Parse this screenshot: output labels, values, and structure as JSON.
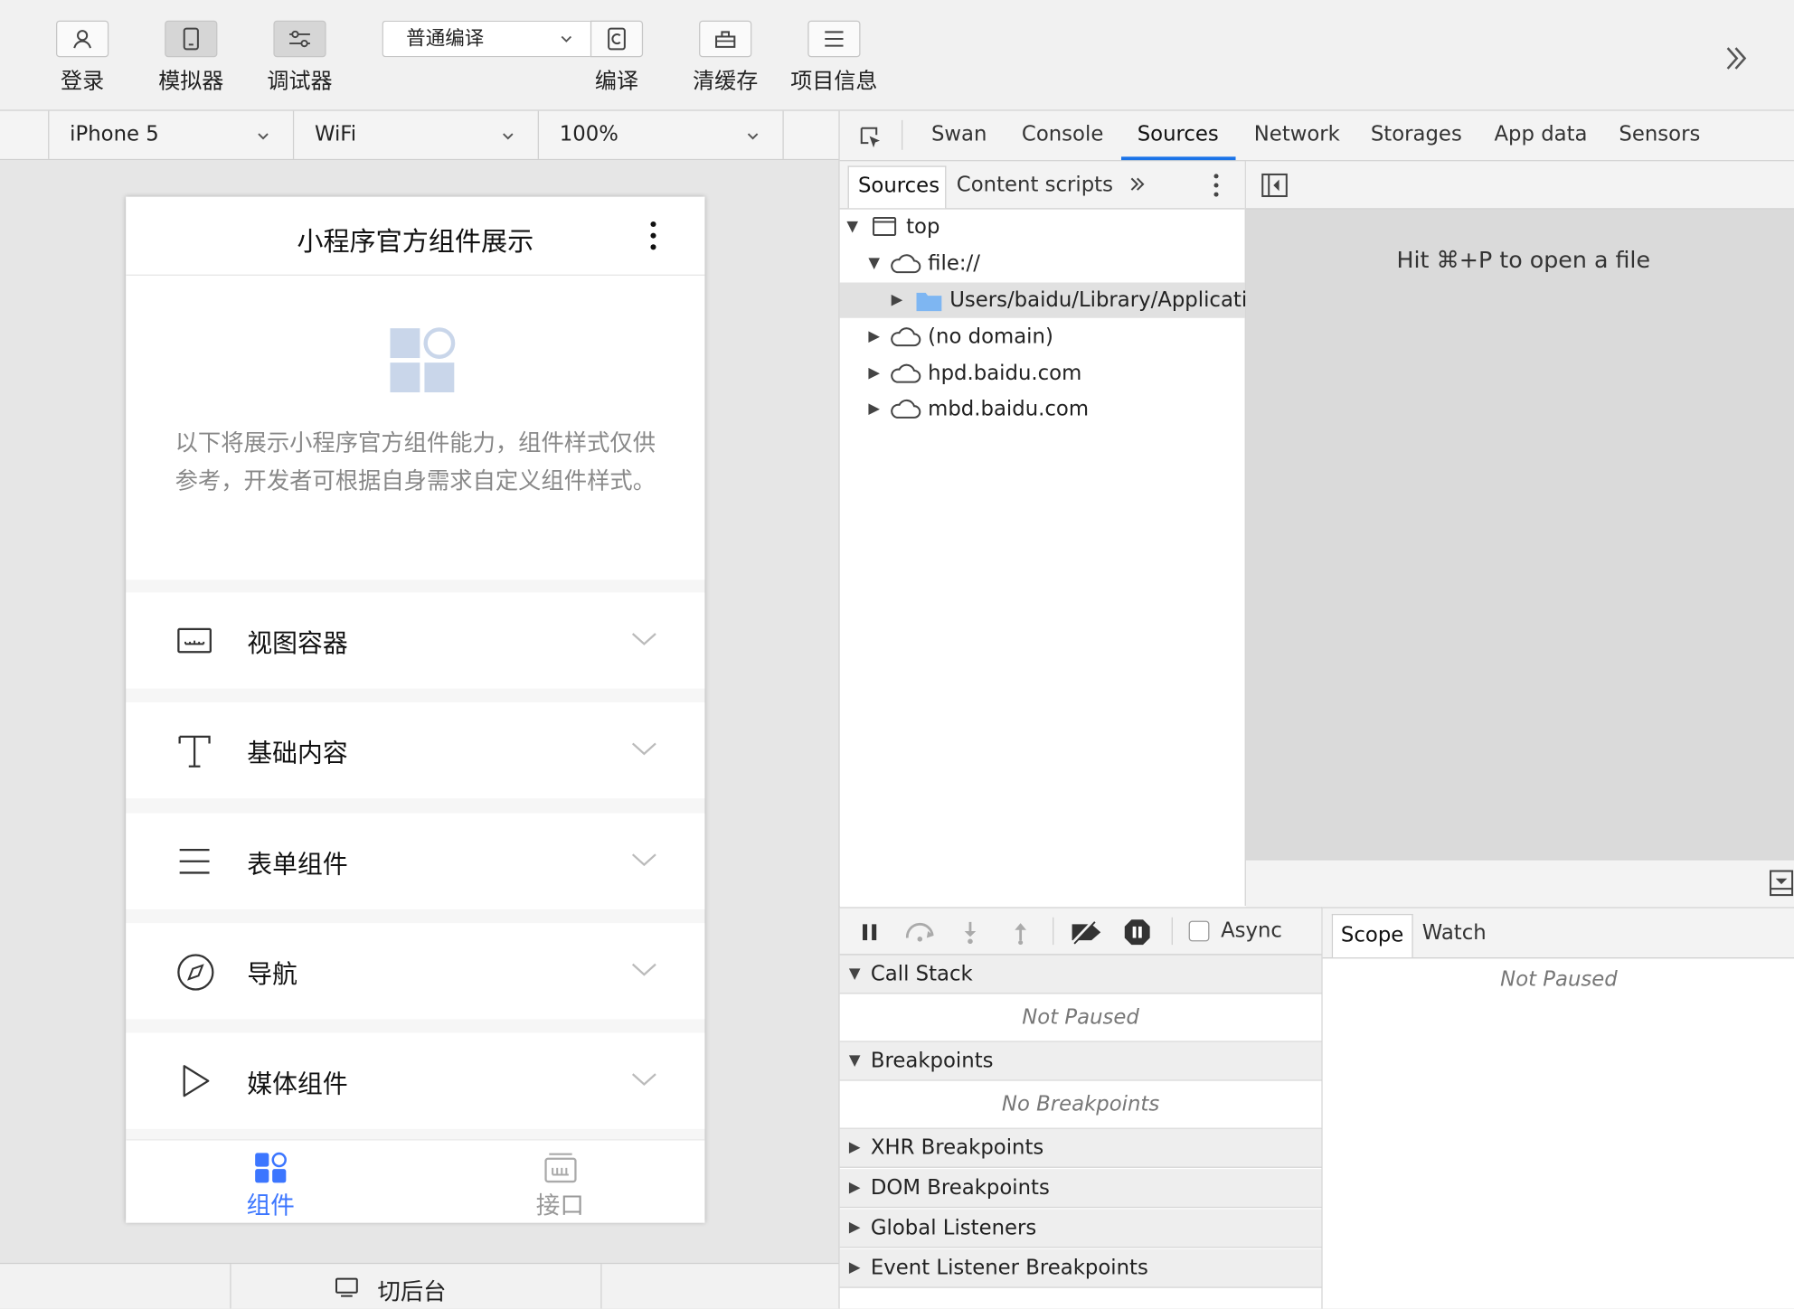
{
  "toolbar": {
    "login": "登录",
    "simulator": "模拟器",
    "debugger": "调试器",
    "compile_mode": "普通编译",
    "compile": "编译",
    "clear_cache": "清缓存",
    "project_info": "项目信息"
  },
  "device_bar": {
    "device": "iPhone 5",
    "network": "WiFi",
    "zoom": "100%"
  },
  "phone": {
    "title": "小程序官方组件展示",
    "intro": "以下将展示小程序官方组件能力，组件样式仅供参考，开发者可根据自身需求自定义组件样式。",
    "components": [
      "视图容器",
      "基础内容",
      "表单组件",
      "导航",
      "媒体组件"
    ],
    "tabs": [
      "组件",
      "接口"
    ],
    "accent": "#3c76ff"
  },
  "background_switch": "切后台",
  "devtools": {
    "tabs": [
      "Swan",
      "Console",
      "Sources",
      "Network",
      "Storages",
      "App data",
      "Sensors"
    ],
    "active_tab": "Sources",
    "navigator_tabs": [
      "Sources",
      "Content scripts"
    ],
    "tree": [
      "top",
      "file://",
      "Users/baidu/Library/Applicatio",
      "(no domain)",
      "hpd.baidu.com",
      "mbd.baidu.com"
    ],
    "editor_hint": "Hit ⌘+P to open a file",
    "debugger": {
      "async_label": "Async",
      "call_stack": "Call Stack",
      "call_stack_status": "Not Paused",
      "breakpoints": "Breakpoints",
      "breakpoints_status": "No Breakpoints",
      "xhr": "XHR Breakpoints",
      "dom": "DOM Breakpoints",
      "global": "Global Listeners",
      "event": "Event Listener Breakpoints"
    },
    "scope_tabs": [
      "Scope",
      "Watch"
    ],
    "scope_status": "Not Paused"
  }
}
